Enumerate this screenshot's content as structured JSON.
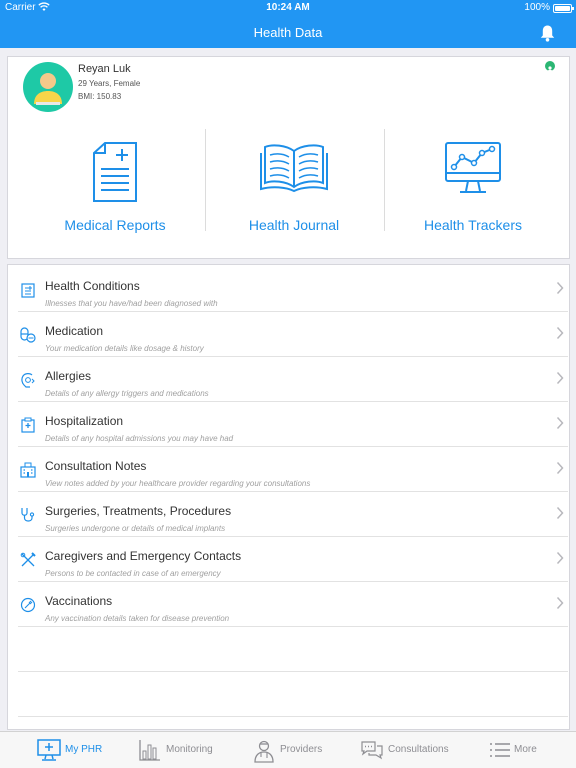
{
  "status_bar": {
    "carrier": "Carrier",
    "time": "10:24 AM",
    "battery": "100%"
  },
  "nav": {
    "title": "Health Data"
  },
  "profile": {
    "name": "Reyan Luk",
    "age_gender": "29 Years, Female",
    "bmi": "BMI: 150.83"
  },
  "tiles": [
    {
      "label": "Medical Reports",
      "icon": "medical-report-icon"
    },
    {
      "label": "Health Journal",
      "icon": "open-book-icon"
    },
    {
      "label": "Health Trackers",
      "icon": "tracker-monitor-icon"
    }
  ],
  "records": [
    {
      "title": "Health Conditions",
      "subtitle": "Illnesses that you have/had been diagnosed with",
      "icon": "clipboard-icon"
    },
    {
      "title": "Medication",
      "subtitle": "Your medication details like dosage & history",
      "icon": "pills-icon"
    },
    {
      "title": "Allergies",
      "subtitle": "Details of any allergy triggers and medications",
      "icon": "allergy-face-icon"
    },
    {
      "title": "Hospitalization",
      "subtitle": "Details of any hospital admissions you may have had",
      "icon": "hospital-clipboard-icon"
    },
    {
      "title": "Consultation Notes",
      "subtitle": "View notes added by your healthcare provider regarding your consultations",
      "icon": "building-icon"
    },
    {
      "title": "Surgeries, Treatments, Procedures",
      "subtitle": "Surgeries undergone or details of medical implants",
      "icon": "stethoscope-icon"
    },
    {
      "title": "Caregivers and Emergency Contacts",
      "subtitle": "Persons to be contacted in case of an emergency",
      "icon": "crossed-tools-icon"
    },
    {
      "title": "Vaccinations",
      "subtitle": "Any vaccination details taken for disease prevention",
      "icon": "vaccine-icon"
    }
  ],
  "tabs": [
    {
      "label": "My PHR",
      "icon": "phr-monitor-icon",
      "active": true
    },
    {
      "label": "Monitoring",
      "icon": "bar-chart-icon",
      "active": false
    },
    {
      "label": "Providers",
      "icon": "doctor-icon",
      "active": false
    },
    {
      "label": "Consultations",
      "icon": "chat-bubbles-icon",
      "active": false
    },
    {
      "label": "More",
      "icon": "menu-list-icon",
      "active": false
    }
  ],
  "colors": {
    "primary": "#2196f3",
    "accent": "#1e8fe8",
    "avatar_bg": "#1ec9a6"
  }
}
